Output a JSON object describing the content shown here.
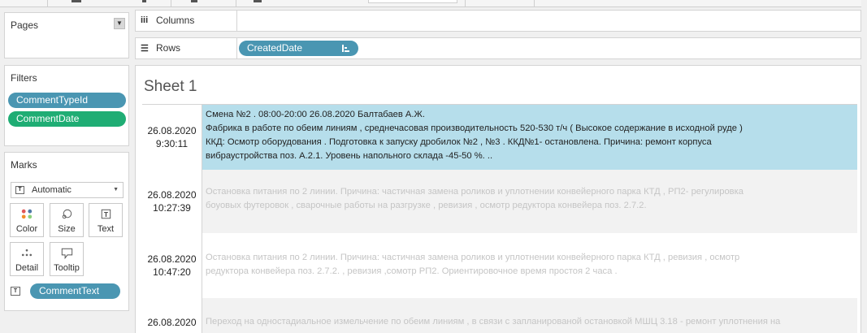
{
  "pages_panel": {
    "title": "Pages",
    "dropdown_icon": "caret-down"
  },
  "filters_panel": {
    "title": "Filters",
    "pills": [
      {
        "label": "CommentTypeId",
        "color": "#4a96b2"
      },
      {
        "label": "CommentDate",
        "color": "#1fad74"
      }
    ]
  },
  "marks_panel": {
    "title": "Marks",
    "mark_type": "Automatic",
    "buttons": [
      {
        "label": "Color",
        "icon": "color-dots-icon"
      },
      {
        "label": "Size",
        "icon": "size-icon"
      },
      {
        "label": "Text",
        "icon": "text-icon"
      },
      {
        "label": "Detail",
        "icon": "detail-icon"
      },
      {
        "label": "Tooltip",
        "icon": "tooltip-icon"
      }
    ],
    "text_pill": "CommentText"
  },
  "shelves": {
    "columns_label": "Columns",
    "rows_label": "Rows",
    "rows_pill": "CreatedDate"
  },
  "sheet": {
    "title": "Sheet 1",
    "rows": [
      {
        "date": "26.08.2020",
        "time": "9:30:11",
        "lines": [
          "Смена №2 . 08:00-20:00 26.08.2020 Балтабаев А.Ж.",
          "Фабрика в работе по обеим линиям , среднечасовая производительность 520-530 т/ч ( Высокое содержание в исходной руде )",
          "ККД: Осмотр оборудования . Подготовка к запуску дробилок №2 , №3 . ККД№1- остановлена. Причина: ремонт корпуса",
          "вибраустройства поз. А.2.1. Уровень напольного склада -45-50 %. .."
        ]
      },
      {
        "date": "26.08.2020",
        "time": "10:27:39",
        "lines": [
          "Остановка питания по 2 линии. Причина: частичная замена роликов и уплотнении конвейерного парка КТД , РП2- регулировка",
          "боуовых футеровок , сварочные работы на разгрузке , ревизия , осмотр редуктора конвейера поз. 2.7.2."
        ]
      },
      {
        "date": "26.08.2020",
        "time": "10:47:20",
        "lines": [
          "Остановка питания по 2 линии. Причина: частичная замена роликов и уплотнении конвейерного парка КТД , ревизия , осмотр",
          "редуктора конвейера поз. 2.7.2. , ревизия ,сомотр РП2. Ориентировочное время простоя 2 часа ."
        ]
      },
      {
        "date": "26.08.2020",
        "time": "",
        "lines": [
          "Переход на одностадиальное измельчение по обеим линиям , в связи с запланированой остановкой МШЦ 3.18 - ремонт уплотнения на"
        ]
      }
    ]
  }
}
